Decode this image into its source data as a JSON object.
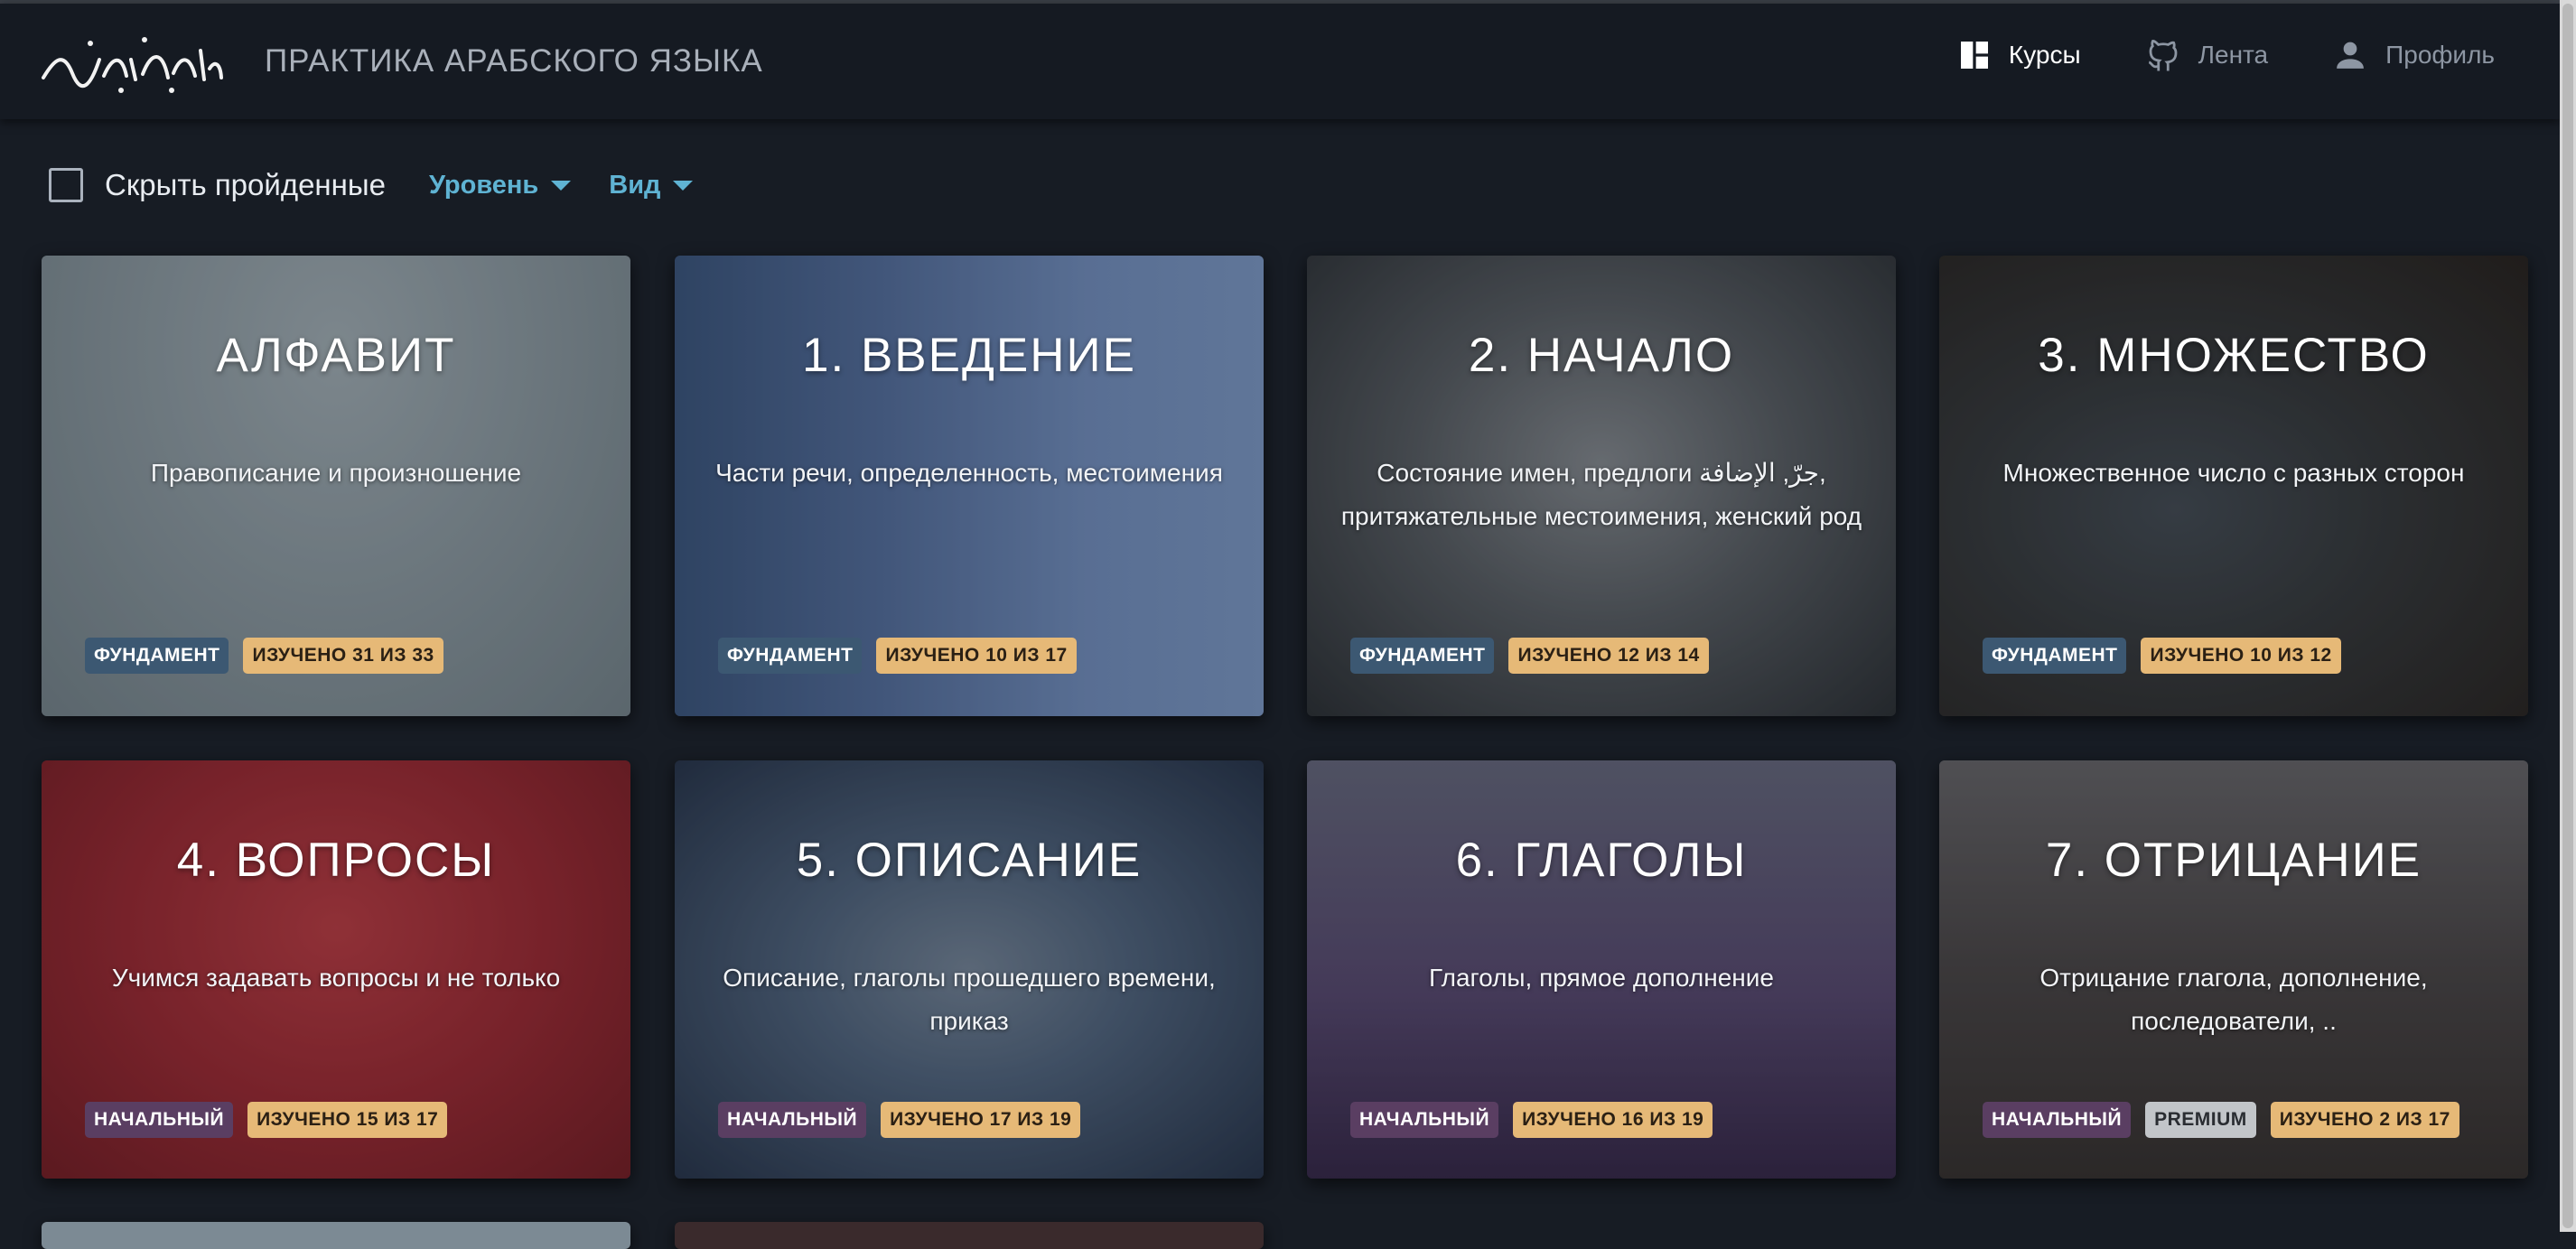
{
  "header": {
    "logo_text": "وَقُل رَّبِّ زِدْنِي عِلْمًا",
    "title": "ПРАКТИКА АРАБСКОГО ЯЗЫКА",
    "nav": [
      {
        "label": "Курсы",
        "icon": "dashboard-icon",
        "active": true
      },
      {
        "label": "Лента",
        "icon": "github-icon",
        "active": false
      },
      {
        "label": "Профиль",
        "icon": "person-icon",
        "active": false
      }
    ]
  },
  "toolbar": {
    "hide_completed_label": "Скрыть пройденные",
    "hide_completed_checked": false,
    "level_label": "Уровень",
    "view_label": "Вид"
  },
  "cards": [
    {
      "title": "АЛФАВИТ",
      "subtitle": "Правописание и произношение",
      "badges": [
        "ФУНДАМЕНТ",
        "ИЗУЧЕНО 31 ИЗ 33"
      ]
    },
    {
      "title": "1. ВВЕДЕНИЕ",
      "subtitle": "Части речи, определенность, местоимения",
      "badges": [
        "ФУНДАМЕНТ",
        "ИЗУЧЕНО 10 ИЗ 17"
      ]
    },
    {
      "title": "2. НАЧАЛО",
      "subtitle": "Состояние имен, предлоги جرّ, الإضافة, притяжательные местоимения, женский род",
      "badges": [
        "ФУНДАМЕНТ",
        "ИЗУЧЕНО 12 ИЗ 14"
      ]
    },
    {
      "title": "3. МНОЖЕСТВО",
      "subtitle": "Множественное число с разных сторон",
      "badges": [
        "ФУНДАМЕНТ",
        "ИЗУЧЕНО 10 ИЗ 12"
      ]
    },
    {
      "title": "4. ВОПРОСЫ",
      "subtitle": "Учимся задавать вопросы и не только",
      "badges": [
        "НАЧАЛЬНЫЙ",
        "ИЗУЧЕНО 15 ИЗ 17"
      ]
    },
    {
      "title": "5. ОПИСАНИЕ",
      "subtitle": "Описание, глаголы прошедшего времени, приказ",
      "badges": [
        "НАЧАЛЬНЫЙ",
        "ИЗУЧЕНО 17 ИЗ 19"
      ]
    },
    {
      "title": "6. ГЛАГОЛЫ",
      "subtitle": "Глаголы, прямое дополнение",
      "badges": [
        "НАЧАЛЬНЫЙ",
        "ИЗУЧЕНО 16 ИЗ 19"
      ]
    },
    {
      "title": "7. ОТРИЦАНИЕ",
      "subtitle": "Отрицание глагола, дополнение, последователи, ..",
      "badges": [
        "НАЧАЛЬНЫЙ",
        "PREMIUM",
        "ИЗУЧЕНО 2 ИЗ 17"
      ]
    }
  ],
  "colors": {
    "background": "#171c24",
    "accent": "#5fb3d3",
    "badge_fundament": "#3c5872",
    "badge_beginner": "#5a3e62",
    "badge_premium": "#c2c5c9",
    "badge_progress": "#e6b977"
  }
}
